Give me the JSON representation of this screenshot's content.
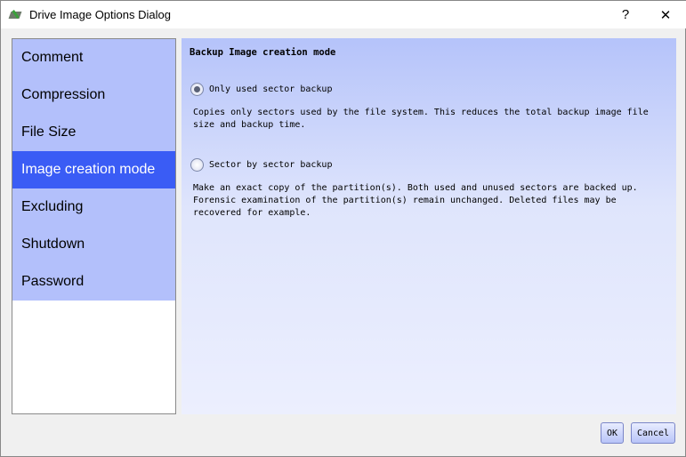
{
  "window": {
    "title": "Drive Image Options Dialog",
    "help_label": "?",
    "close_label": "✕"
  },
  "sidebar": {
    "items": [
      {
        "label": "Comment",
        "active": false
      },
      {
        "label": "Compression",
        "active": false
      },
      {
        "label": "File Size",
        "active": false
      },
      {
        "label": "Image creation mode",
        "active": true
      },
      {
        "label": "Excluding",
        "active": false
      },
      {
        "label": "Shutdown",
        "active": false
      },
      {
        "label": "Password",
        "active": false
      }
    ]
  },
  "main": {
    "heading": "Backup Image creation mode",
    "options": [
      {
        "label": "Only used sector backup",
        "selected": true,
        "description": "Copies only sectors used by the file system. This reduces the total backup image file size and backup time."
      },
      {
        "label": "Sector by sector backup",
        "selected": false,
        "description": "Make an exact copy of the partition(s). Both used and unused sectors are backed up. Forensic examination of the partition(s) remain unchanged. Deleted files may be recovered for example."
      }
    ]
  },
  "footer": {
    "ok_label": "OK",
    "cancel_label": "Cancel"
  }
}
